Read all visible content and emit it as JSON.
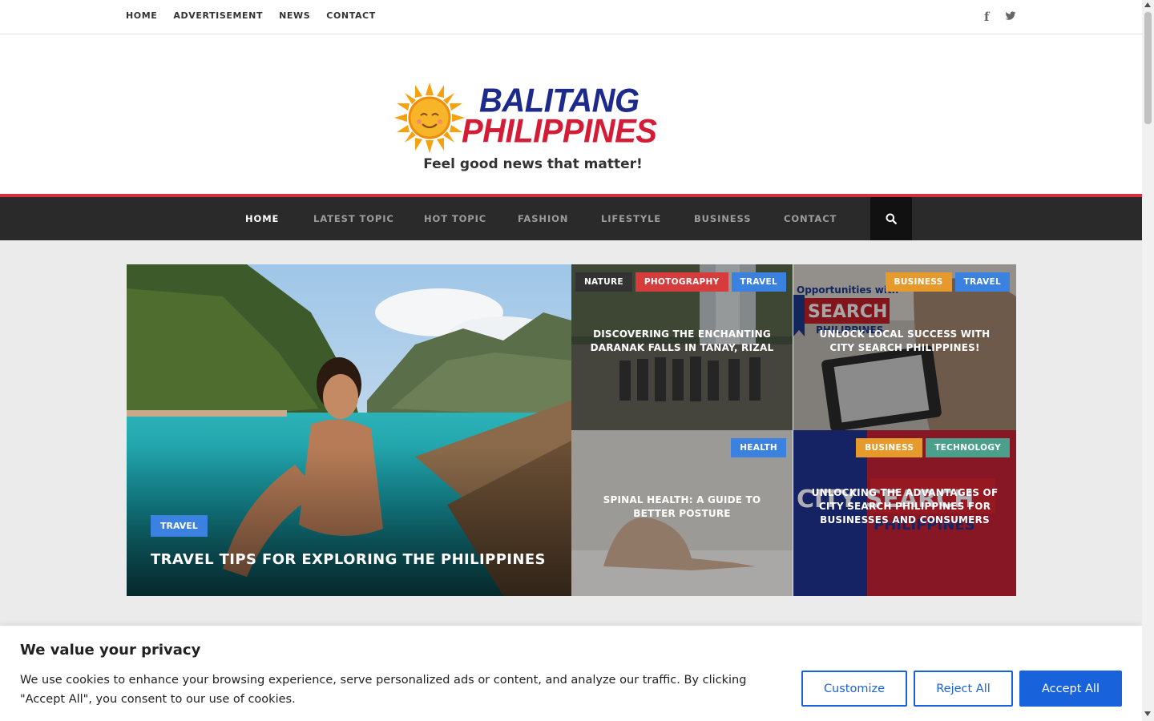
{
  "topbar": {
    "links": [
      "HOME",
      "ADVERTISEMENT",
      "NEWS",
      "CONTACT"
    ],
    "social": [
      {
        "icon": "facebook-icon",
        "glyph": "f"
      },
      {
        "icon": "twitter-icon"
      }
    ]
  },
  "header": {
    "logo_line1": "BALITANG",
    "logo_line2": "PHILIPPINES",
    "tagline": "Feel good news that matter!"
  },
  "nav": {
    "items": [
      {
        "label": "HOME",
        "active": true
      },
      {
        "label": "LATEST TOPIC",
        "active": false
      },
      {
        "label": "HOT TOPIC",
        "active": false
      },
      {
        "label": "FASHION",
        "active": false
      },
      {
        "label": "LIFESTYLE",
        "active": false
      },
      {
        "label": "BUSINESS",
        "active": false
      },
      {
        "label": "CONTACT",
        "active": false
      }
    ],
    "search_icon": "search-icon"
  },
  "featured": {
    "main": {
      "tag": "TRAVEL",
      "title": "TRAVEL TIPS FOR EXPLORING THE PHILIPPINES"
    },
    "cards": [
      {
        "tags": [
          "NATURE",
          "PHOTOGRAPHY",
          "TRAVEL"
        ],
        "title": "DISCOVERING THE ENCHANTING DARANAK FALLS IN TANAY, RIZAL"
      },
      {
        "tags": [
          "BUSINESS",
          "TRAVEL"
        ],
        "title": "UNLOCK LOCAL SUCCESS WITH CITY SEARCH PHILIPPINES!",
        "image_text": [
          "Opportunities with",
          "SEARCH",
          "PHILIPPINES"
        ]
      },
      {
        "tags": [
          "HEALTH"
        ],
        "title": "SPINAL HEALTH: A GUIDE TO BETTER POSTURE"
      },
      {
        "tags": [
          "BUSINESS",
          "TECHNOLOGY"
        ],
        "title": "UNLOCKING THE ADVANTAGES OF CITY SEARCH PHILIPPINES FOR BUSINESSES AND CONSUMERS",
        "image_text": [
          "CITY SEARCH",
          "PHILIPPINES"
        ]
      }
    ]
  },
  "cookie": {
    "title": "We value your privacy",
    "text": "We use cookies to enhance your browsing experience, serve personalized ads or content, and analyze our traffic. By clicking \"Accept All\", you consent to our use of cookies.",
    "customize": "Customize",
    "reject": "Reject All",
    "accept": "Accept All"
  },
  "colors": {
    "accent_red": "#d9303f",
    "nav_bg": "#2a2a2a",
    "cookie_blue": "#1863dc",
    "logo_blue": "#1c2a8c",
    "logo_red": "#d51c36"
  }
}
